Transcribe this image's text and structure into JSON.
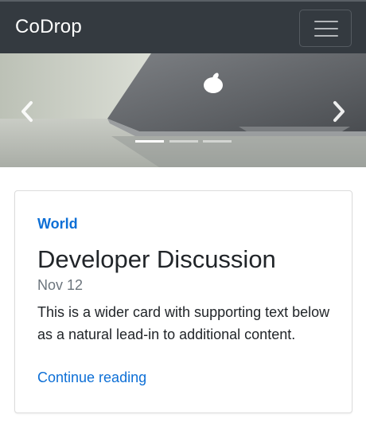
{
  "navbar": {
    "brand": "CoDrop",
    "toggler_icon": "hamburger-menu-icon"
  },
  "carousel": {
    "image_subject": "laptop",
    "prev_icon": "chevron-left-icon",
    "next_icon": "chevron-right-icon",
    "slide_count": 3,
    "active_index": 0
  },
  "card": {
    "category": "World",
    "title": "Developer Discussion",
    "date": "Nov 12",
    "text": "This is a wider card with supporting text below as a natural lead-in to additional content.",
    "link": "Continue reading"
  },
  "colors": {
    "navbar_bg": "#343a40",
    "link": "#0d6fd6",
    "muted": "#6c757d"
  }
}
